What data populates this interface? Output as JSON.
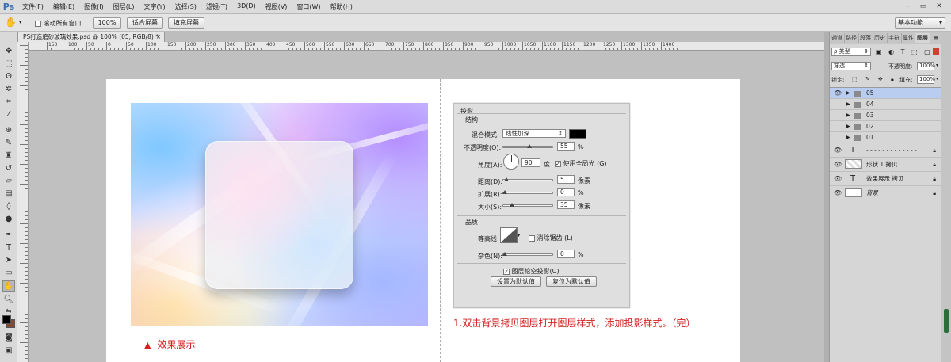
{
  "menubar": {
    "logo": "Ps",
    "items": [
      "文件(F)",
      "编辑(E)",
      "图像(I)",
      "图层(L)",
      "文字(Y)",
      "选择(S)",
      "滤镜(T)",
      "3D(D)",
      "视图(V)",
      "窗口(W)",
      "帮助(H)"
    ],
    "minimize": "–",
    "restore": "▭",
    "close": "✕"
  },
  "options": {
    "scroll_all_label": "滚动所有窗口",
    "zoom_value": "100%",
    "fit_screen": "适合屏幕",
    "fill_screen": "填充屏幕",
    "workspace": "基本功能"
  },
  "document": {
    "tab_title": "PS打造磨砂玻璃效果.psd @ 100% (05, RGB/8) *",
    "tab_close": "×"
  },
  "ruler": {
    "labels": [
      "150",
      "100",
      "50",
      "0",
      "50",
      "100",
      "150",
      "200",
      "250",
      "300",
      "350",
      "400",
      "450",
      "500",
      "550",
      "600",
      "650",
      "700",
      "750",
      "800",
      "850",
      "900",
      "950",
      "1000",
      "1050",
      "1100",
      "1150",
      "1200",
      "1250",
      "1300",
      "1350",
      "1400"
    ]
  },
  "canvas": {
    "caption_left_icon": "▲",
    "caption_left": "效果展示",
    "caption_right": "1.双击背景拷贝图层打开图层样式，添加投影样式。（完）"
  },
  "dialog": {
    "title": "投影",
    "structure": "结构",
    "blend_mode_label": "混合模式:",
    "blend_mode_value": "线性加深",
    "opacity_label": "不透明度(O):",
    "opacity_value": "55",
    "opacity_unit": "%",
    "angle_label": "角度(A):",
    "angle_value": "90",
    "angle_unit": "度",
    "global_light": "使用全局光 (G)",
    "distance_label": "距离(D):",
    "distance_value": "5",
    "distance_unit": "像素",
    "spread_label": "扩展(R):",
    "spread_value": "0",
    "spread_unit": "%",
    "size_label": "大小(S):",
    "size_value": "35",
    "size_unit": "像素",
    "quality": "品质",
    "contour_label": "等高线:",
    "antialias": "消除锯齿 (L)",
    "noise_label": "杂色(N):",
    "noise_value": "0",
    "noise_unit": "%",
    "knockout": "图层挖空投影(U)",
    "set_default": "设置为默认值",
    "reset_default": "复位为默认值",
    "shadow_color": "#000000"
  },
  "layers_panel": {
    "tabs": [
      "通道",
      "路径",
      "段落",
      "历史",
      "字符",
      "属性",
      "图层"
    ],
    "filter_label": "ρ 类型",
    "blend_mode": "穿透",
    "opacity_label": "不透明度:",
    "opacity_value": "100%",
    "lock_label": "锁定:",
    "fill_label": "填充:",
    "fill_value": "100%",
    "layers": [
      {
        "name": "05",
        "type": "group",
        "visible": true,
        "selected": true
      },
      {
        "name": "04",
        "type": "group",
        "visible": false
      },
      {
        "name": "03",
        "type": "group",
        "visible": false
      },
      {
        "name": "02",
        "type": "group",
        "visible": false
      },
      {
        "name": "01",
        "type": "group",
        "visible": false
      },
      {
        "name": "- - - - - - - - - - - - -",
        "type": "text",
        "visible": true,
        "locked": true
      },
      {
        "name": "形状 1 拷贝",
        "type": "shape",
        "visible": true,
        "locked": true
      },
      {
        "name": "效果展示 拷贝",
        "type": "text",
        "visible": true,
        "locked": true
      },
      {
        "name": "背景",
        "type": "background",
        "visible": true,
        "locked": true
      }
    ]
  },
  "colors": {
    "accent_red": "#d42020",
    "selection": "#b9cdf0",
    "foreground": "#000000",
    "background_color": "#8a4a2a"
  }
}
